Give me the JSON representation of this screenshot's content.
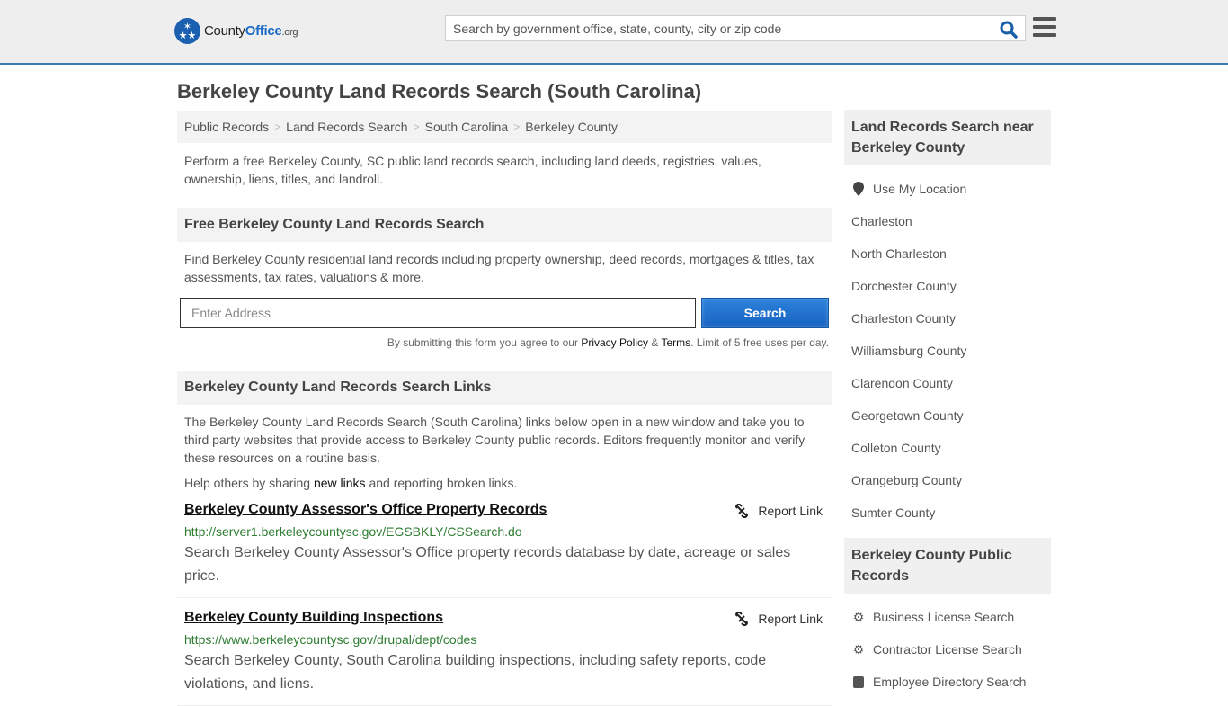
{
  "header": {
    "logo": {
      "county": "County",
      "office": "Office",
      "tld": ".org"
    },
    "search_placeholder": "Search by government office, state, county, city or zip code",
    "icons": {
      "search": "search-icon",
      "menu": "hamburger-menu-icon"
    }
  },
  "page": {
    "title": "Berkeley County Land Records Search (South Carolina)",
    "breadcrumb": [
      "Public Records",
      "Land Records Search",
      "South Carolina",
      "Berkeley County"
    ],
    "intro": "Perform a free Berkeley County, SC public land records search, including land deeds, registries, values, ownership, liens, titles, and landroll."
  },
  "free_search": {
    "heading": "Free Berkeley County Land Records Search",
    "text": "Find Berkeley County residential land records including property ownership, deed records, mortgages & titles, tax assessments, tax rates, valuations & more.",
    "address_placeholder": "Enter Address",
    "search_button": "Search",
    "terms_prefix": "By submitting this form you agree to our ",
    "privacy_link": "Privacy Policy",
    "amp": " & ",
    "terms_link": "Terms",
    "terms_suffix": ". Limit of 5 free uses per day."
  },
  "links_section": {
    "heading": "Berkeley County Land Records Search Links",
    "text": "The Berkeley County Land Records Search (South Carolina) links below open in a new window and take you to third party websites that provide access to Berkeley County public records. Editors frequently monitor and verify these resources on a routine basis.",
    "share_prefix": "Help others by sharing ",
    "share_link": "new links",
    "share_suffix": " and reporting broken links.",
    "report_label": "Report Link",
    "items": [
      {
        "title": "Berkeley County Assessor's Office Property Records",
        "url": "http://server1.berkeleycountysc.gov/EGSBKLY/CSSearch.do",
        "description": "Search Berkeley County Assessor's Office property records database by date, acreage or sales price."
      },
      {
        "title": "Berkeley County Building Inspections",
        "url": "https://www.berkeleycountysc.gov/drupal/dept/codes",
        "description": "Search Berkeley County, South Carolina building inspections, including safety reports, code violations, and liens."
      }
    ]
  },
  "sidebar": {
    "nearby_heading": "Land Records Search near Berkeley County",
    "use_location": "Use My Location",
    "nearby": [
      "Charleston",
      "North Charleston",
      "Dorchester County",
      "Charleston County",
      "Williamsburg County",
      "Clarendon County",
      "Georgetown County",
      "Colleton County",
      "Orangeburg County",
      "Sumter County"
    ],
    "public_heading": "Berkeley County Public Records",
    "public_records": [
      {
        "label": "Business License Search",
        "icon": "gears-icon"
      },
      {
        "label": "Contractor License Search",
        "icon": "gear-icon"
      },
      {
        "label": "Employee Directory Search",
        "icon": "directory-icon"
      }
    ]
  }
}
